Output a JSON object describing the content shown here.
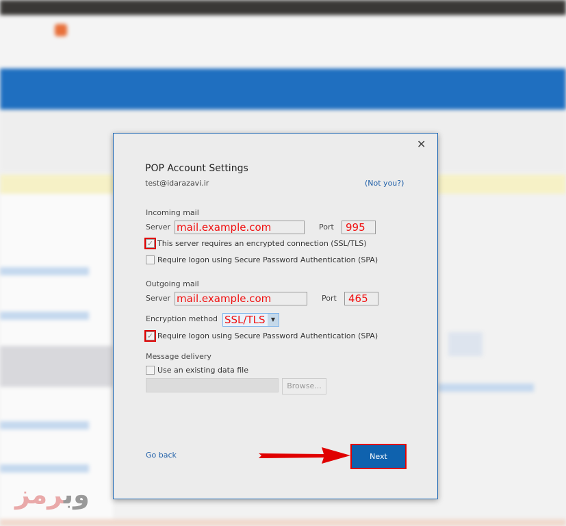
{
  "dialog": {
    "title": "POP Account Settings",
    "email": "test@idarazavi.ir",
    "not_you": "(Not you?)",
    "close_icon": "close-icon",
    "incoming": {
      "heading": "Incoming mail",
      "server_label": "Server",
      "server": "mail.example.com",
      "port_label": "Port",
      "port": "995",
      "ssl_label": "This server requires an encrypted connection (SSL/TLS)",
      "ssl_checked": true,
      "spa_label": "Require logon using Secure Password Authentication (SPA)",
      "spa_checked": false
    },
    "outgoing": {
      "heading": "Outgoing mail",
      "server_label": "Server",
      "server": "mail.example.com",
      "port_label": "Port",
      "port": "465",
      "encryption_label": "Encryption method",
      "encryption": "SSL/TLS",
      "spa_label": "Require logon using Secure Password Authentication (SPA)",
      "spa_checked": true
    },
    "delivery": {
      "heading": "Message delivery",
      "existing_label": "Use an existing data file",
      "existing_checked": false,
      "path": "",
      "browse": "Browse..."
    },
    "go_back": "Go back",
    "next": "Next"
  },
  "watermark": {
    "text": "وب رمز"
  },
  "colors": {
    "accent": "#0f62ae",
    "highlight": "#e00000"
  }
}
